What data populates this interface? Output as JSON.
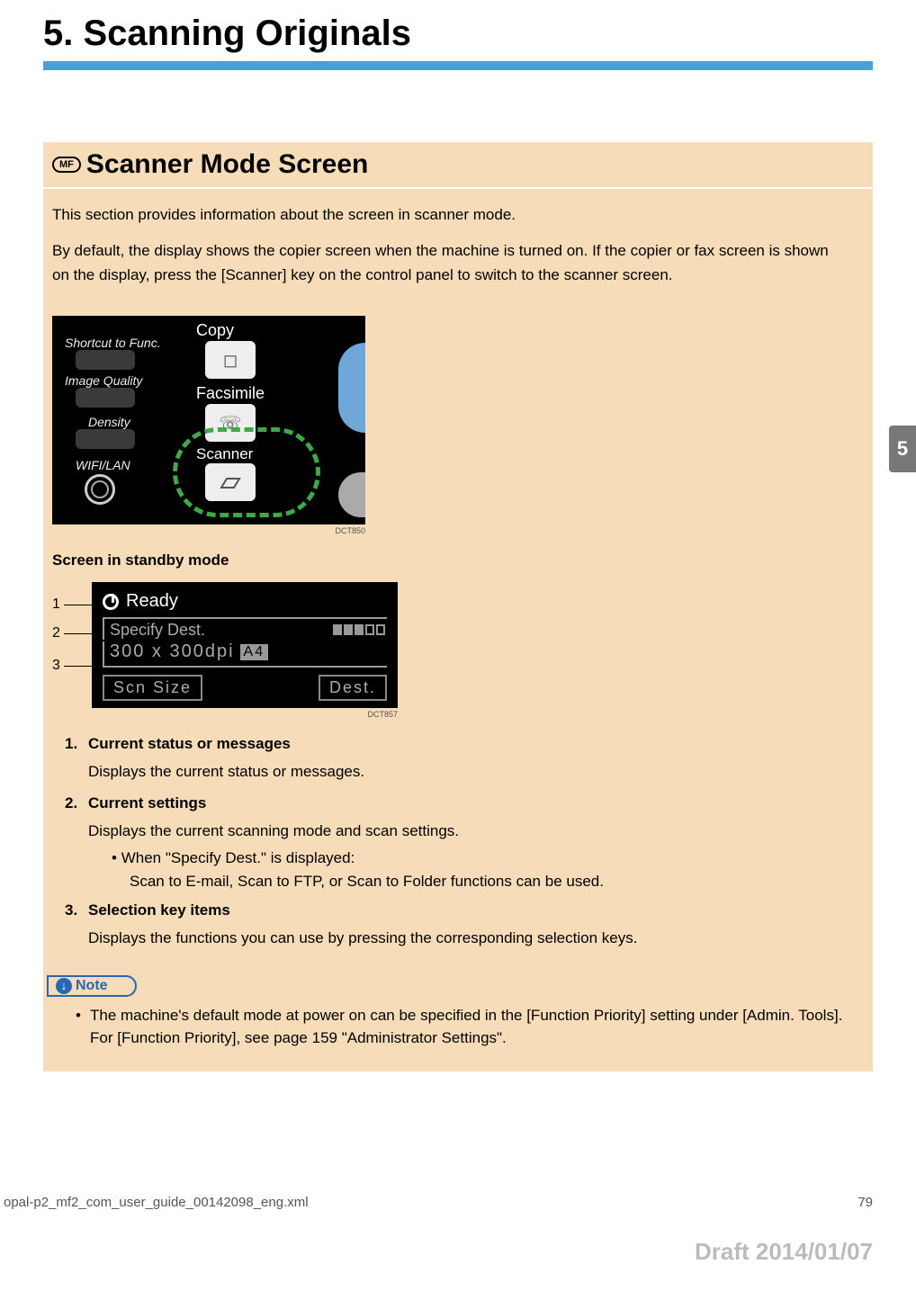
{
  "chapter_title": "5. Scanning Originals",
  "tab_number": "5",
  "section": {
    "mf_label": "MF",
    "title": "Scanner Mode Screen",
    "intro1": "This section provides information about the screen in scanner mode.",
    "intro2": "By default, the display shows the copier screen when the machine is turned on. If the copier or fax screen is shown on the display, press the [Scanner] key on the control panel to switch to the scanner screen."
  },
  "panel": {
    "shortcut": "Shortcut to Func.",
    "image_quality": "Image Quality",
    "density": "Density",
    "wifi": "WIFI/LAN",
    "copy": "Copy",
    "facsimile": "Facsimile",
    "scanner": "Scanner",
    "fig_id": "DCT850"
  },
  "standby": {
    "heading": "Screen in standby mode",
    "callout1": "1",
    "callout2": "2",
    "callout3": "3",
    "ready": "Ready",
    "specify_dest": "Specify Dest.",
    "resolution": "300 x 300dpi",
    "a4": "A4",
    "scn_size": "Scn Size",
    "dest": "Dest.",
    "fig_id": "DCT857"
  },
  "items": {
    "i1": {
      "num": "1.",
      "title": "Current status or messages",
      "desc": "Displays the current status or messages."
    },
    "i2": {
      "num": "2.",
      "title": "Current settings",
      "desc": "Displays the current scanning mode and scan settings.",
      "sub_label": "When \"Specify Dest.\" is displayed:",
      "sub_desc": "Scan to E-mail, Scan to FTP, or Scan to Folder functions can be used."
    },
    "i3": {
      "num": "3.",
      "title": "Selection key items",
      "desc": "Displays the functions you can use by pressing the corresponding selection keys."
    }
  },
  "note": {
    "label": "Note",
    "text": "The machine's default mode at power on can be specified in the [Function Priority] setting under [Admin. Tools]. For [Function Priority], see page 159 \"Administrator Settings\"."
  },
  "footer": {
    "file": "opal-p2_mf2_com_user_guide_00142098_eng.xml",
    "page": "79",
    "draft": "Draft 2014/01/07"
  }
}
